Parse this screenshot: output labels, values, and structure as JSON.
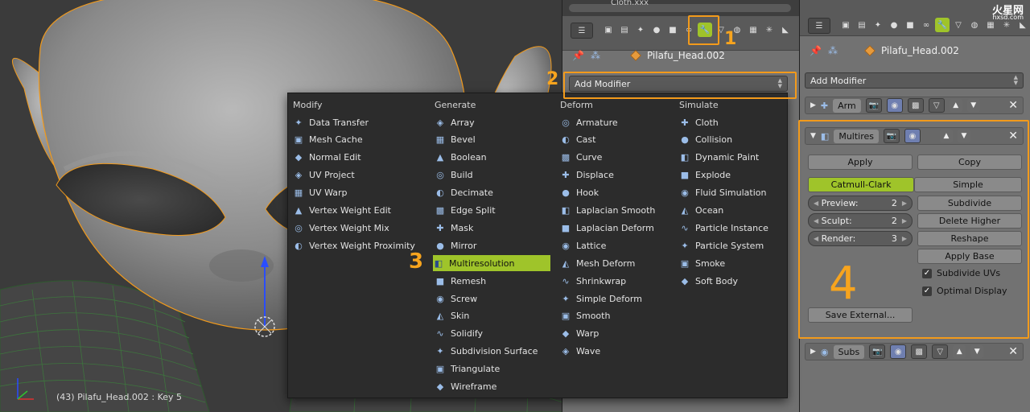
{
  "viewport": {
    "status_text": "(43) Pilafu_Head.002 : Key 5"
  },
  "top_tab_partial": "Cloth.xxx",
  "mid_panel": {
    "object_name": "Pilafu_Head.002",
    "add_modifier": "Add Modifier"
  },
  "right_panel": {
    "object_name": "Pilafu_Head.002",
    "add_modifier": "Add Modifier",
    "mod_arm": {
      "name": "Arm"
    },
    "mod_multires": {
      "name": "Multires",
      "apply": "Apply",
      "copy": "Copy",
      "catmull": "Catmull-Clark",
      "simple": "Simple",
      "preview_label": "Preview:",
      "preview_val": "2",
      "sculpt_label": "Sculpt:",
      "sculpt_val": "2",
      "render_label": "Render:",
      "render_val": "3",
      "subdivide": "Subdivide",
      "delete_higher": "Delete Higher",
      "reshape": "Reshape",
      "apply_base": "Apply Base",
      "subdivide_uvs": "Subdivide UVs",
      "optimal_display": "Optimal Display",
      "save_external": "Save External..."
    },
    "mod_subs": {
      "name": "Subs"
    }
  },
  "menu": {
    "columns": [
      {
        "title": "Modify",
        "items": [
          "Data Transfer",
          "Mesh Cache",
          "Normal Edit",
          "UV Project",
          "UV Warp",
          "Vertex Weight Edit",
          "Vertex Weight Mix",
          "Vertex Weight Proximity"
        ]
      },
      {
        "title": "Generate",
        "items": [
          "Array",
          "Bevel",
          "Boolean",
          "Build",
          "Decimate",
          "Edge Split",
          "Mask",
          "Mirror",
          "Multiresolution",
          "Remesh",
          "Screw",
          "Skin",
          "Solidify",
          "Subdivision Surface",
          "Triangulate",
          "Wireframe"
        ]
      },
      {
        "title": "Deform",
        "items": [
          "Armature",
          "Cast",
          "Curve",
          "Displace",
          "Hook",
          "Laplacian Smooth",
          "Laplacian Deform",
          "Lattice",
          "Mesh Deform",
          "Shrinkwrap",
          "Simple Deform",
          "Smooth",
          "Warp",
          "Wave"
        ]
      },
      {
        "title": "Simulate",
        "items": [
          "Cloth",
          "Collision",
          "Dynamic Paint",
          "Explode",
          "Fluid Simulation",
          "Ocean",
          "Particle Instance",
          "Particle System",
          "Smoke",
          "Soft Body"
        ]
      }
    ],
    "highlighted": "Multiresolution"
  },
  "annotations": {
    "step1": "1",
    "step2": "2",
    "step3": "3",
    "step4": "4"
  },
  "watermark": {
    "logo_text": "火星网",
    "url": "hxsd.com"
  },
  "colors": {
    "accent": "#9fc42a",
    "highlight_box": "#f29a1b",
    "panel_bg": "#727272",
    "menu_bg": "#2c2c2c"
  }
}
